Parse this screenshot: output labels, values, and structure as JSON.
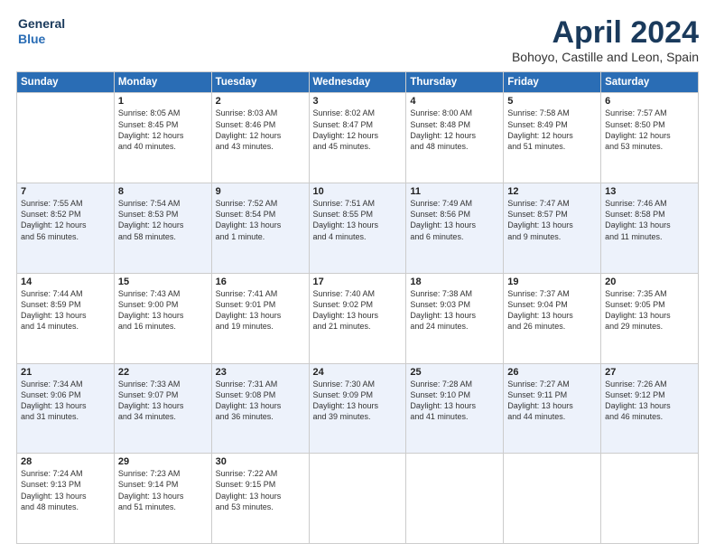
{
  "header": {
    "logo_line1": "General",
    "logo_line2": "Blue",
    "title": "April 2024",
    "subtitle": "Bohoyo, Castille and Leon, Spain"
  },
  "columns": [
    "Sunday",
    "Monday",
    "Tuesday",
    "Wednesday",
    "Thursday",
    "Friday",
    "Saturday"
  ],
  "weeks": [
    [
      {
        "day": "",
        "info": ""
      },
      {
        "day": "1",
        "info": "Sunrise: 8:05 AM\nSunset: 8:45 PM\nDaylight: 12 hours\nand 40 minutes."
      },
      {
        "day": "2",
        "info": "Sunrise: 8:03 AM\nSunset: 8:46 PM\nDaylight: 12 hours\nand 43 minutes."
      },
      {
        "day": "3",
        "info": "Sunrise: 8:02 AM\nSunset: 8:47 PM\nDaylight: 12 hours\nand 45 minutes."
      },
      {
        "day": "4",
        "info": "Sunrise: 8:00 AM\nSunset: 8:48 PM\nDaylight: 12 hours\nand 48 minutes."
      },
      {
        "day": "5",
        "info": "Sunrise: 7:58 AM\nSunset: 8:49 PM\nDaylight: 12 hours\nand 51 minutes."
      },
      {
        "day": "6",
        "info": "Sunrise: 7:57 AM\nSunset: 8:50 PM\nDaylight: 12 hours\nand 53 minutes."
      }
    ],
    [
      {
        "day": "7",
        "info": "Sunrise: 7:55 AM\nSunset: 8:52 PM\nDaylight: 12 hours\nand 56 minutes."
      },
      {
        "day": "8",
        "info": "Sunrise: 7:54 AM\nSunset: 8:53 PM\nDaylight: 12 hours\nand 58 minutes."
      },
      {
        "day": "9",
        "info": "Sunrise: 7:52 AM\nSunset: 8:54 PM\nDaylight: 13 hours\nand 1 minute."
      },
      {
        "day": "10",
        "info": "Sunrise: 7:51 AM\nSunset: 8:55 PM\nDaylight: 13 hours\nand 4 minutes."
      },
      {
        "day": "11",
        "info": "Sunrise: 7:49 AM\nSunset: 8:56 PM\nDaylight: 13 hours\nand 6 minutes."
      },
      {
        "day": "12",
        "info": "Sunrise: 7:47 AM\nSunset: 8:57 PM\nDaylight: 13 hours\nand 9 minutes."
      },
      {
        "day": "13",
        "info": "Sunrise: 7:46 AM\nSunset: 8:58 PM\nDaylight: 13 hours\nand 11 minutes."
      }
    ],
    [
      {
        "day": "14",
        "info": "Sunrise: 7:44 AM\nSunset: 8:59 PM\nDaylight: 13 hours\nand 14 minutes."
      },
      {
        "day": "15",
        "info": "Sunrise: 7:43 AM\nSunset: 9:00 PM\nDaylight: 13 hours\nand 16 minutes."
      },
      {
        "day": "16",
        "info": "Sunrise: 7:41 AM\nSunset: 9:01 PM\nDaylight: 13 hours\nand 19 minutes."
      },
      {
        "day": "17",
        "info": "Sunrise: 7:40 AM\nSunset: 9:02 PM\nDaylight: 13 hours\nand 21 minutes."
      },
      {
        "day": "18",
        "info": "Sunrise: 7:38 AM\nSunset: 9:03 PM\nDaylight: 13 hours\nand 24 minutes."
      },
      {
        "day": "19",
        "info": "Sunrise: 7:37 AM\nSunset: 9:04 PM\nDaylight: 13 hours\nand 26 minutes."
      },
      {
        "day": "20",
        "info": "Sunrise: 7:35 AM\nSunset: 9:05 PM\nDaylight: 13 hours\nand 29 minutes."
      }
    ],
    [
      {
        "day": "21",
        "info": "Sunrise: 7:34 AM\nSunset: 9:06 PM\nDaylight: 13 hours\nand 31 minutes."
      },
      {
        "day": "22",
        "info": "Sunrise: 7:33 AM\nSunset: 9:07 PM\nDaylight: 13 hours\nand 34 minutes."
      },
      {
        "day": "23",
        "info": "Sunrise: 7:31 AM\nSunset: 9:08 PM\nDaylight: 13 hours\nand 36 minutes."
      },
      {
        "day": "24",
        "info": "Sunrise: 7:30 AM\nSunset: 9:09 PM\nDaylight: 13 hours\nand 39 minutes."
      },
      {
        "day": "25",
        "info": "Sunrise: 7:28 AM\nSunset: 9:10 PM\nDaylight: 13 hours\nand 41 minutes."
      },
      {
        "day": "26",
        "info": "Sunrise: 7:27 AM\nSunset: 9:11 PM\nDaylight: 13 hours\nand 44 minutes."
      },
      {
        "day": "27",
        "info": "Sunrise: 7:26 AM\nSunset: 9:12 PM\nDaylight: 13 hours\nand 46 minutes."
      }
    ],
    [
      {
        "day": "28",
        "info": "Sunrise: 7:24 AM\nSunset: 9:13 PM\nDaylight: 13 hours\nand 48 minutes."
      },
      {
        "day": "29",
        "info": "Sunrise: 7:23 AM\nSunset: 9:14 PM\nDaylight: 13 hours\nand 51 minutes."
      },
      {
        "day": "30",
        "info": "Sunrise: 7:22 AM\nSunset: 9:15 PM\nDaylight: 13 hours\nand 53 minutes."
      },
      {
        "day": "",
        "info": ""
      },
      {
        "day": "",
        "info": ""
      },
      {
        "day": "",
        "info": ""
      },
      {
        "day": "",
        "info": ""
      }
    ]
  ]
}
